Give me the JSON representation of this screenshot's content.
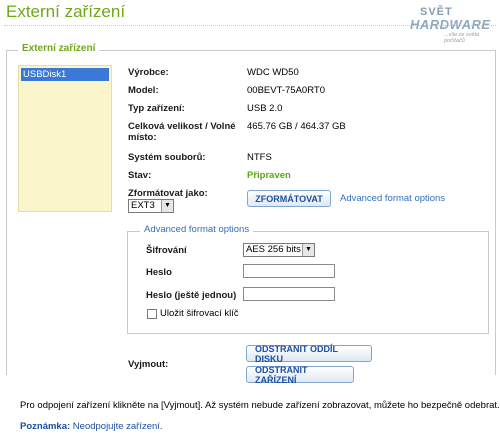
{
  "page": {
    "title": "Externí zařízení"
  },
  "logo": {
    "line1": "SVĚT",
    "line2": "HARDWARE",
    "tagline": "...vše ze světa počítačů"
  },
  "section": {
    "legend": "Externí zařízení"
  },
  "disks": [
    "USBDisk1"
  ],
  "details": {
    "vendor_label": "Výrobce:",
    "vendor_value": "WDC WD50",
    "model_label": "Model:",
    "model_value": "00BEVT-75A0RT0",
    "type_label": "Typ zařízení:",
    "type_value": "USB 2.0",
    "size_label_1": "Celková velikost / Volné",
    "size_label_2": "místo:",
    "size_value": "465.76 GB / 464.37 GB",
    "fs_label": "Systém souborů:",
    "fs_value": "NTFS",
    "state_label": "Stav:",
    "state_value": "Připraven",
    "format_label": "Zformátovat jako:",
    "format_select": "EXT3",
    "format_button": "ZFORMÁTOVAT",
    "advanced_link": "Advanced format options"
  },
  "advanced": {
    "legend": "Advanced format options",
    "encryption_label": "Šifrování",
    "encryption_select": "AES 256 bits",
    "password_label": "Heslo",
    "password_value": "",
    "password_repeat_label": "Heslo (ještě jednou)",
    "password_repeat_value": "",
    "save_key_label": "Uložit šifrovací klíč",
    "save_key_checked": false
  },
  "eject": {
    "label": "Vyjmout:",
    "remove_partition_button": "ODSTRANIT ODDÍL DISKU",
    "remove_device_button": "ODSTRANIT ZAŘÍZENÍ"
  },
  "footer": {
    "info": "Pro odpojení zařízení klikněte na [Vyjmout]. Až systém nebude zařízení zobrazovat, můžete ho bezpečně odebrat.",
    "note_label": "Poznámka:",
    "note_text": "Neodpojujte zařízení."
  },
  "colors": {
    "accent_green": "#6ea817",
    "link_blue": "#2f6fc0",
    "selection_blue": "#3a79d6",
    "list_background": "#fbf5cb"
  }
}
